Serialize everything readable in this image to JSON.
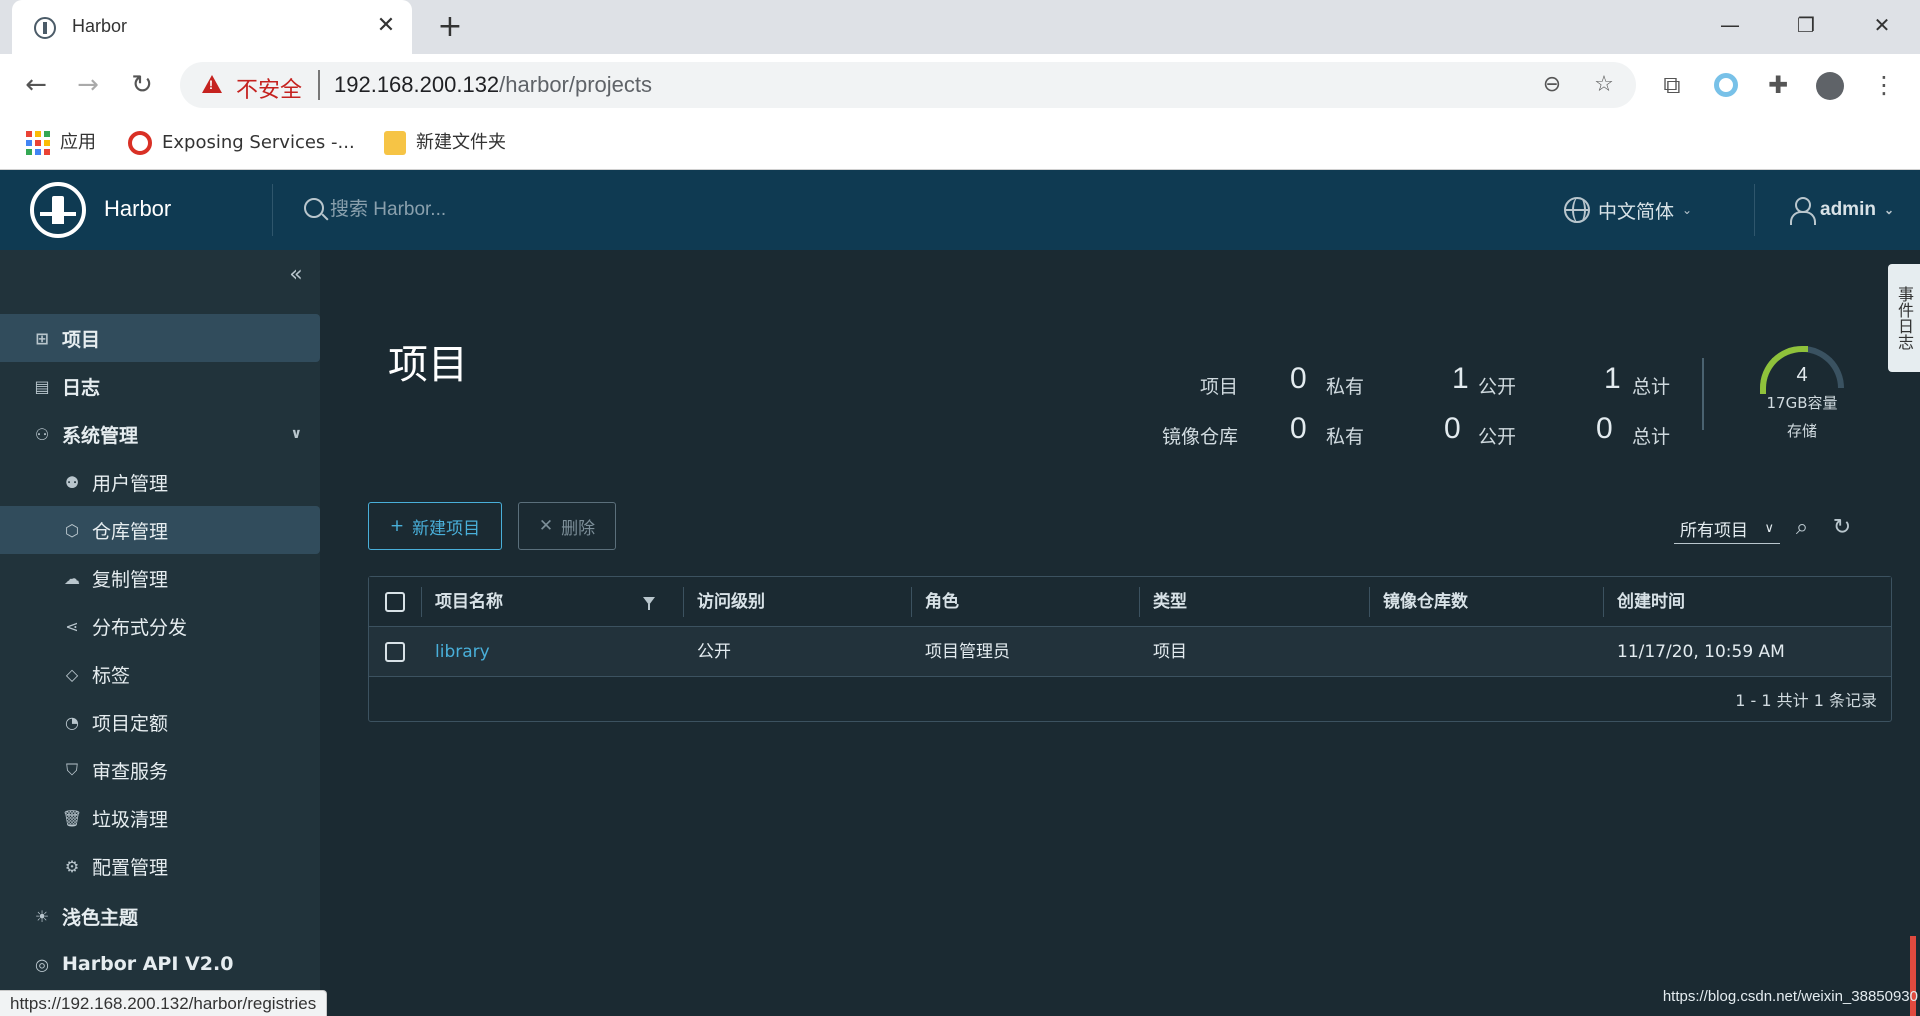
{
  "browser": {
    "tab_title": "Harbor",
    "insecure_label": "不安全",
    "url_host": "192.168.200.132",
    "url_path": "/harbor/projects",
    "bookmarks": [
      {
        "label": "应用"
      },
      {
        "label": "Exposing Services -..."
      },
      {
        "label": "新建文件夹"
      }
    ],
    "status_url": "https://192.168.200.132/harbor/registries",
    "watermark": "https://blog.csdn.net/weixin_38850930"
  },
  "header": {
    "brand": "Harbor",
    "search_placeholder": "搜索 Harbor...",
    "language": "中文简体",
    "user": "admin"
  },
  "sidebar": {
    "items": [
      {
        "label": "项目",
        "icon": "projects-icon"
      },
      {
        "label": "日志",
        "icon": "logs-icon"
      },
      {
        "label": "系统管理",
        "icon": "admin-icon"
      },
      {
        "label": "用户管理",
        "icon": "users-icon"
      },
      {
        "label": "仓库管理",
        "icon": "registry-icon"
      },
      {
        "label": "复制管理",
        "icon": "replication-icon"
      },
      {
        "label": "分布式分发",
        "icon": "distribution-icon"
      },
      {
        "label": "标签",
        "icon": "tag-icon"
      },
      {
        "label": "项目定额",
        "icon": "quota-icon"
      },
      {
        "label": "审查服务",
        "icon": "shield-icon"
      },
      {
        "label": "垃圾清理",
        "icon": "trash-icon"
      },
      {
        "label": "配置管理",
        "icon": "gear-icon"
      },
      {
        "label": "浅色主题",
        "icon": "sun-icon"
      },
      {
        "label": "Harbor API V2.0",
        "icon": "api-icon"
      }
    ]
  },
  "main": {
    "title": "项目",
    "stats": {
      "row1_label": "项目",
      "row2_label": "镜像仓库",
      "private_label": "私有",
      "public_label": "公开",
      "total_label": "总计",
      "projects": {
        "private": "0",
        "public": "1",
        "total": "1"
      },
      "repos": {
        "private": "0",
        "public": "0",
        "total": "0"
      }
    },
    "quota": {
      "value": "4",
      "capacity": "17GB容量",
      "storage": "存储",
      "used_fraction": 0.25
    },
    "buttons": {
      "new_project": "新建项目",
      "delete": "删除"
    },
    "filter": {
      "selected": "所有项目"
    },
    "table": {
      "headers": [
        "项目名称",
        "访问级别",
        "角色",
        "类型",
        "镜像仓库数",
        "创建时间"
      ],
      "rows": [
        {
          "name": "library",
          "access": "公开",
          "role": "项目管理员",
          "type": "项目",
          "repo_count": "",
          "created": "11/17/20, 10:59 AM"
        }
      ],
      "footer": "1 - 1 共计 1 条记录"
    },
    "notice_tab": "事件日志"
  },
  "colors": {
    "header_bg": "#0f3a52",
    "sidebar_bg": "#21333b",
    "main_bg": "#1b2a32",
    "accent": "#49afd9"
  }
}
